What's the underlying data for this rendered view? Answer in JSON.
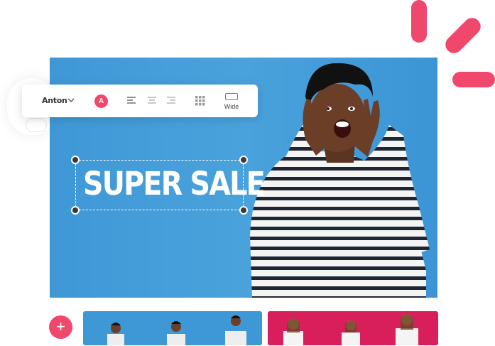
{
  "toolbar": {
    "font_name": "Anton",
    "color_badge": "A",
    "wide_label": "Wide"
  },
  "canvas": {
    "headline": "SUPER SALE"
  },
  "timeline": {
    "add_label": "+"
  },
  "colors": {
    "accent": "#f0476d",
    "canvas_blue": "#3f98d6",
    "thumb_pink": "#d81f5b"
  }
}
